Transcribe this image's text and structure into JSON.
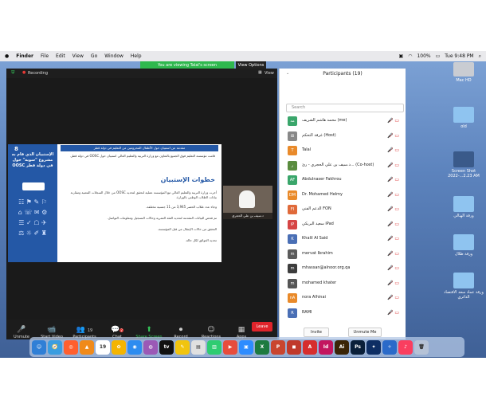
{
  "menubar": {
    "app": "Finder",
    "items": [
      "File",
      "Edit",
      "View",
      "Go",
      "Window",
      "Help"
    ],
    "battery": "100%",
    "clock": "Tue 9:48 PM"
  },
  "share": {
    "banner": "You are viewing Talal's screen",
    "view_options": "View Options"
  },
  "zoom": {
    "recording": "Recording",
    "view": "View",
    "toolbar": [
      {
        "label": "Unmute",
        "icon": "🎤",
        "name": "unmute-button"
      },
      {
        "label": "Start Video",
        "icon": "📹",
        "name": "start-video-button"
      },
      {
        "label": "Participants",
        "icon": "👥",
        "name": "participants-button"
      },
      {
        "label": "Chat",
        "icon": "💬",
        "name": "chat-button"
      },
      {
        "label": "Share Screen",
        "icon": "⬆",
        "name": "share-screen-button"
      },
      {
        "label": "Record",
        "icon": "⏺",
        "name": "record-button"
      },
      {
        "label": "Reactions",
        "icon": "☺",
        "name": "reactions-button"
      },
      {
        "label": "Apps",
        "icon": "▦",
        "name": "apps-button"
      }
    ],
    "participants_count": "19",
    "chat_badge": "2",
    "leave": "Leave",
    "video_name": "د.سيف بن علي الحجري"
  },
  "slide": {
    "left_title": "الإستبيان الذي قام به مشروع \"سوية\" حول OOSC في دولة قطر",
    "header_band": "مقدمة عن استبيان حول الأطفال المحرومين من التعليم في دولة قطر",
    "intro": "قامت مؤسسة التعليم فوق الجميع بالتعاون مع وزارة التربية والتعليم العالي استبيان حول OOSC في دولة قطر.",
    "steps_title": "خطوات الإستبيان",
    "bullets": [
      "أجرت وزارة التربية والتعليم العالي مع المؤسسة عملية لتحقق لتحديد OOSC من خلال السجلات المعنية ومقارنة بيانات الطلاب الوطني بالوزارة.",
      "وجاء عدد طلاب الحصر 3,945 من 11 جنسية مختلفة.",
      "تم فحص البيانات المقدمة لتحديد الفئة العمرية وحالات التسجيل ومعلومات التواصل.",
      "التحقق من حالات الإنتقال من قبل المؤسسة.",
      "تحديد العوائق لكل حالة."
    ]
  },
  "panel": {
    "title": "Participants (19)",
    "search_placeholder": "Search",
    "participants": [
      {
        "initials": "مه",
        "name": "محمد هاشم الشريف (me)",
        "color": "#3aa66b"
      },
      {
        "initials": "⊞",
        "name": "غرفة التحكم (Host)",
        "color": "#888888"
      },
      {
        "initials": "T",
        "name": "Talal",
        "color": "#e98a2a"
      },
      {
        "initials": "ر",
        "name": "د.سيف بن علي الحجري - رئ... (Co-host)",
        "color": "#5a8c3f"
      },
      {
        "initials": "AF",
        "name": "Abdulnaser Fakhrou",
        "color": "#3aa66b"
      },
      {
        "initials": "DM",
        "name": "Dr. Mohamed Helmy",
        "color": "#e98a2a"
      },
      {
        "initials": "FI",
        "name": "الدعم الفني FON",
        "color": "#e06a3a"
      },
      {
        "initials": "iP",
        "name": "سعيد البريكي iPad",
        "color": "#d64545"
      },
      {
        "initials": "K",
        "name": "Khalil Al Said",
        "color": "#4a6fb5"
      },
      {
        "initials": "m",
        "name": "mervat Ibrahim",
        "color": "#5b5b5b"
      },
      {
        "initials": "m",
        "name": "mhassan@alnoor.org.qa",
        "color": "#3d3d3d"
      },
      {
        "initials": "m",
        "name": "mohamed khater",
        "color": "#555555"
      },
      {
        "initials": "nA",
        "name": "nora Alhinai",
        "color": "#e98a2a"
      },
      {
        "initials": "R",
        "name": "RAMI",
        "color": "#4a6fb5"
      }
    ],
    "invite": "Invite",
    "unmute_me": "Unmute Me"
  },
  "desktop": {
    "icons": [
      {
        "label": "Mac HD",
        "kind": "drive"
      },
      {
        "label": "old",
        "kind": "folder"
      },
      {
        "label": "Screen Shot 2022-...2.23 AM",
        "kind": "folder"
      },
      {
        "label": "ورقة الهتالي",
        "kind": "folder"
      },
      {
        "label": "ورقة طلال",
        "kind": "folder"
      },
      {
        "label": "ورقة عماد سعد الاقتصاد الدائري",
        "kind": "folder"
      }
    ]
  },
  "dock": [
    {
      "icon": "☺",
      "color": "#2f7fd6"
    },
    {
      "icon": "🧭",
      "color": "#3a9de0"
    },
    {
      "icon": "◎",
      "color": "#ff5f2e"
    },
    {
      "icon": "▲",
      "color": "#f08a1a"
    },
    {
      "icon": "19",
      "color": "#ffffff"
    },
    {
      "icon": "✿",
      "color": "#f4b400"
    },
    {
      "icon": "◉",
      "color": "#2d8cf0"
    },
    {
      "icon": "◍",
      "color": "#9b59b6"
    },
    {
      "icon": "tv",
      "color": "#111111"
    },
    {
      "icon": "✎",
      "color": "#f1c40f"
    },
    {
      "icon": "▤",
      "color": "#e0e0e0"
    },
    {
      "icon": "▥",
      "color": "#2ecc71"
    },
    {
      "icon": "▶",
      "color": "#e74c3c"
    },
    {
      "icon": "▣",
      "color": "#2d8cff"
    },
    {
      "icon": "X",
      "color": "#1d7a40"
    },
    {
      "icon": "P",
      "color": "#c9452f"
    },
    {
      "icon": "◼",
      "color": "#c0392b"
    },
    {
      "icon": "A",
      "color": "#d62d2d"
    },
    {
      "icon": "Id",
      "color": "#c3155f"
    },
    {
      "icon": "Ai",
      "color": "#3a2406"
    },
    {
      "icon": "Ps",
      "color": "#0a1f3a"
    },
    {
      "icon": "✦",
      "color": "#0e2e64"
    },
    {
      "icon": "✧",
      "color": "#2a6ac9"
    },
    {
      "icon": "♪",
      "color": "#fa3e5f"
    },
    {
      "icon": "🗑",
      "color": "#b5c2d6"
    }
  ]
}
